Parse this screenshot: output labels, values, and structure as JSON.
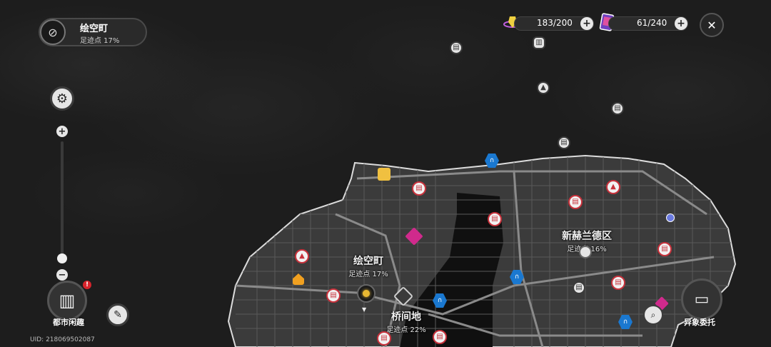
{
  "location": {
    "name": "绘空町",
    "progress": "足迹点 17%"
  },
  "resources": {
    "energy": {
      "value": "183/200",
      "icon": "energy-icon"
    },
    "cards": {
      "value": "61/240",
      "icon": "card-pack-icon"
    }
  },
  "map": {
    "districts": [
      {
        "name": "绘空町",
        "progress": "足迹点 17%"
      },
      {
        "name": "新赫兰德区",
        "progress": "足迹点 16%"
      },
      {
        "name": "桥间地",
        "progress": "足迹点 22%"
      }
    ]
  },
  "controls": {
    "city_leisure": "都市闲趣",
    "commission": "异象委托",
    "badge": "!"
  },
  "uid": "UID: 218069502087",
  "colors": {
    "marker_red": "#c8323c",
    "marker_blue": "#1a78d0",
    "marker_pink": "#d02a8c",
    "player": "#e8b832"
  }
}
